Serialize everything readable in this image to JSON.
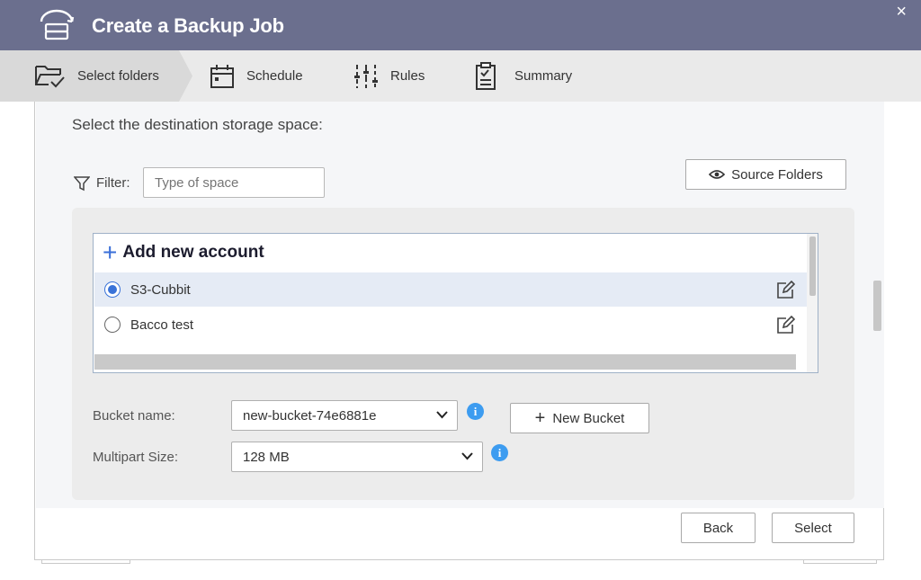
{
  "window": {
    "title": "Create a Backup Job",
    "close_glyph": "×",
    "title_icon": "backup-drive-icon"
  },
  "steps": [
    {
      "label": "Select folders",
      "icon": "folder-check-icon",
      "active": true
    },
    {
      "label": "Schedule",
      "icon": "calendar-icon",
      "active": false
    },
    {
      "label": "Rules",
      "icon": "sliders-icon",
      "active": false
    },
    {
      "label": "Summary",
      "icon": "clipboard-check-icon",
      "active": false
    }
  ],
  "main": {
    "prompt": "Select the destination storage space:",
    "filter_label": "Filter:",
    "filter_placeholder": "Type of space",
    "source_folders_label": "Source Folders",
    "add_account_label": "Add new account",
    "accounts": [
      {
        "name": "S3-Cubbit",
        "selected": true
      },
      {
        "name": "Bacco test",
        "selected": false
      }
    ],
    "bucket_label": "Bucket name:",
    "bucket_value": "new-bucket-74e6881e",
    "new_bucket_label": "New Bucket",
    "multipart_label": "Multipart Size:",
    "multipart_value": "128 MB",
    "info_glyph": "i"
  },
  "footer": {
    "back_label": "Back",
    "select_label": "Select"
  },
  "colors": {
    "titlebar": "#6b6f8e",
    "accent": "#3a73d8",
    "info": "#3d9cf0",
    "selected_row": "#e5ebf5"
  }
}
